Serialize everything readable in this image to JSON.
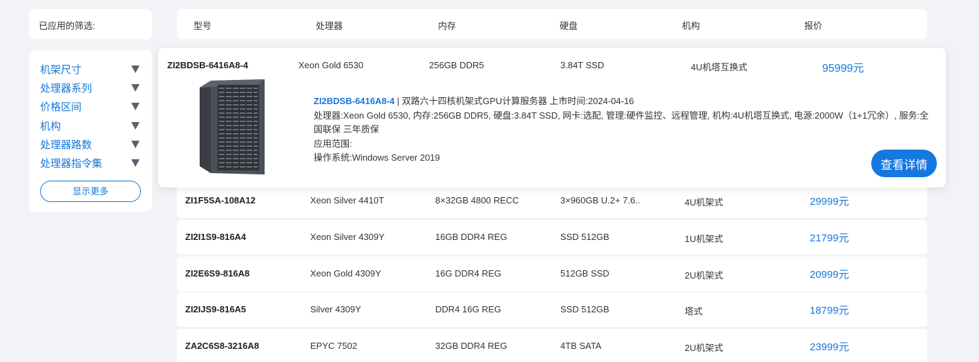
{
  "applied_filters": {
    "label": "已应用的筛选:"
  },
  "filters": {
    "items": [
      {
        "label": "机架尺寸"
      },
      {
        "label": "处理器系列"
      },
      {
        "label": "价格区间"
      },
      {
        "label": "机构"
      },
      {
        "label": "处理器路数"
      },
      {
        "label": "处理器指令集"
      }
    ],
    "more_label": "显示更多"
  },
  "table": {
    "headers": [
      "型号",
      "处理器",
      "内存",
      "硬盘",
      "机构",
      "报价"
    ],
    "expanded": {
      "model": "ZI2BDSB-6416A8-4",
      "cpu": "Xeon Gold 6530",
      "memory": "256GB DDR5",
      "disk": "3.84T SSD",
      "chassis": "4U机塔互换式",
      "price": "95999元",
      "detail_model": "ZI2BDSB-6416A8-4",
      "detail_title": " | 双路六十四核机架式GPU计算服务器     上市时间:2024-04-16",
      "detail_specs": "处理器:Xeon Gold 6530, 内存:256GB DDR5, 硬盘:3.84T SSD, 网卡:选配, 管理:硬件监控、远程管理, 机构:4U机塔互换式, 电源:2000W（1+1冗余）, 服务:全国联保 三年质保",
      "detail_range": "应用范围:",
      "detail_os": "操作系统:Windows Server 2019",
      "detail_button": "查看详情"
    },
    "rows": [
      {
        "model": "ZI1F5SA-108A12",
        "cpu": "Xeon Silver 4410T",
        "memory": "8×32GB 4800 RECC",
        "disk": "3×960GB U.2+ 7.6..",
        "chassis": "4U机架式",
        "price": "29999元"
      },
      {
        "model": "ZI2I1S9-816A4",
        "cpu": "Xeon Silver 4309Y",
        "memory": "16GB DDR4 REG",
        "disk": "SSD 512GB",
        "chassis": "1U机架式",
        "price": "21799元"
      },
      {
        "model": "ZI2E6S9-816A8",
        "cpu": "Xeon Gold 4309Y",
        "memory": "16G DDR4 REG",
        "disk": "512GB SSD",
        "chassis": "2U机架式",
        "price": "20999元"
      },
      {
        "model": "ZI2IJS9-816A5",
        "cpu": "Silver 4309Y",
        "memory": "DDR4 16G REG",
        "disk": "SSD 512GB",
        "chassis": "塔式",
        "price": "18799元"
      },
      {
        "model": "ZA2C6S8-3216A8",
        "cpu": "EPYC 7502",
        "memory": "32GB DDR4 REG",
        "disk": "4TB SATA",
        "chassis": "2U机架式",
        "price": "23999元"
      }
    ]
  },
  "colors": {
    "accent": "#1677d9",
    "background": "#f2f3f7"
  }
}
